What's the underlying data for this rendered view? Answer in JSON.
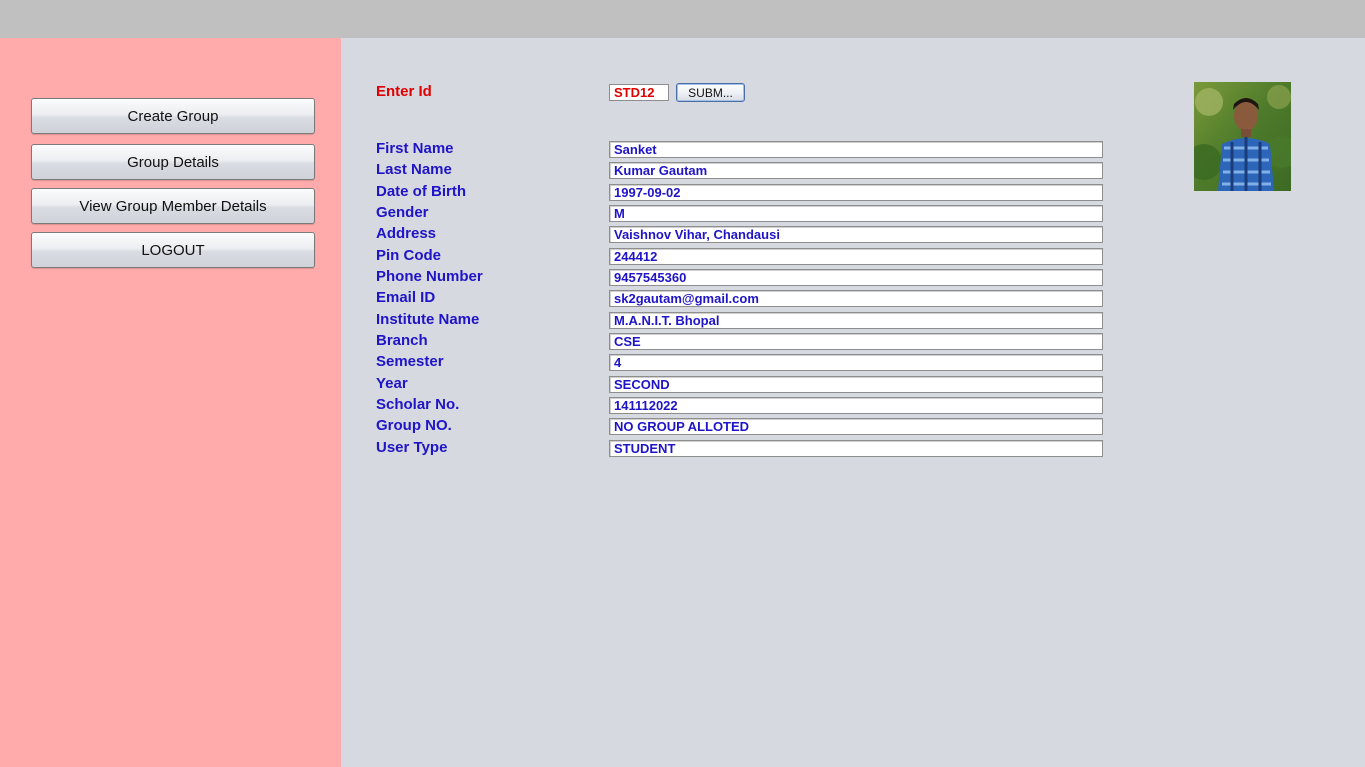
{
  "sidebar": {
    "buttons": [
      {
        "label": "Create Group"
      },
      {
        "label": "Group Details"
      },
      {
        "label": "View Group Member Details"
      },
      {
        "label": "LOGOUT"
      }
    ]
  },
  "lookup": {
    "label": "Enter Id",
    "id_value": "STD12",
    "submit_label": "SUBM..."
  },
  "profile": {
    "photo_icon": "student-photo",
    "fields": [
      {
        "label": "First Name",
        "value": "Sanket"
      },
      {
        "label": "Last Name",
        "value": "Kumar Gautam"
      },
      {
        "label": "Date of Birth",
        "value": "1997-09-02"
      },
      {
        "label": "Gender",
        "value": "M"
      },
      {
        "label": "Address",
        "value": "Vaishnov Vihar, Chandausi"
      },
      {
        "label": "Pin Code",
        "value": "244412"
      },
      {
        "label": "Phone Number",
        "value": "9457545360"
      },
      {
        "label": "Email ID",
        "value": "sk2gautam@gmail.com"
      },
      {
        "label": "Institute Name",
        "value": "M.A.N.I.T. Bhopal"
      },
      {
        "label": "Branch",
        "value": "CSE"
      },
      {
        "label": "Semester",
        "value": "4"
      },
      {
        "label": "Year",
        "value": "SECOND"
      },
      {
        "label": "Scholar No.",
        "value": "141112022"
      },
      {
        "label": "Group NO.",
        "value": "NO GROUP ALLOTED"
      },
      {
        "label": "User Type",
        "value": "STUDENT"
      }
    ]
  },
  "colors": {
    "sidebar_bg": "#ffabab",
    "main_bg": "#d6d9e0",
    "label_blue": "#1f14c8",
    "label_red": "#e00000"
  }
}
